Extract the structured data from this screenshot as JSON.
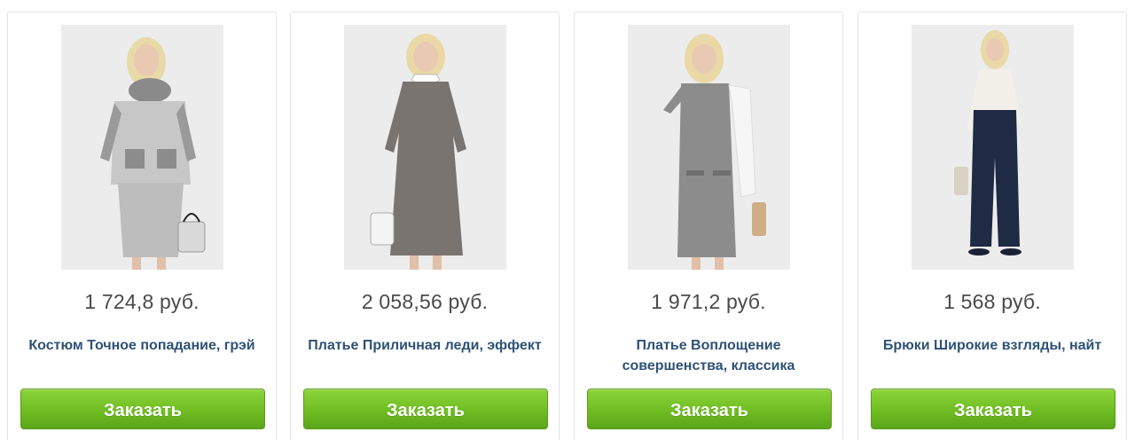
{
  "products": [
    {
      "price": "1 724,8 руб.",
      "title": "Костюм Точное попадание, грэй",
      "button": "Заказать",
      "photo_alt": "Костюм Точное попадание, грэй"
    },
    {
      "price": "2 058,56 руб.",
      "title": "Платье Приличная леди, эффект",
      "button": "Заказать",
      "photo_alt": "Платье Приличная леди, эффект"
    },
    {
      "price": "1 971,2 руб.",
      "title": "Платье Воплощение совершенства, классика",
      "button": "Заказать",
      "photo_alt": "Платье Воплощение совершенства, классика"
    },
    {
      "price": "1 568 руб.",
      "title": "Брюки Широкие взгляды, найт",
      "button": "Заказать",
      "photo_alt": "Брюки Широкие взгляды, найт"
    }
  ],
  "colors": {
    "button_green": "#6fbd22",
    "title_blue": "#2e5275",
    "price_gray": "#4a4a4a",
    "card_border": "#e3e3e3"
  }
}
